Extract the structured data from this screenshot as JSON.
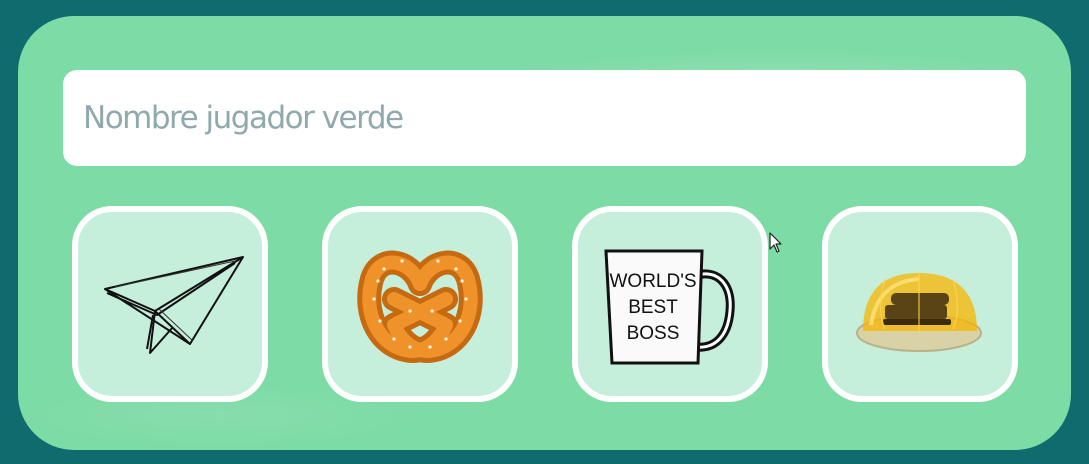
{
  "player_name": {
    "placeholder": "Nombre jugador verde",
    "value": ""
  },
  "tokens": [
    {
      "icon": "paper-airplane-icon"
    },
    {
      "icon": "pretzel-icon"
    },
    {
      "icon": "mug-icon",
      "mug_text": [
        "WORLD'S",
        "BEST",
        "BOSS"
      ]
    },
    {
      "icon": "stapler-in-jello-icon"
    }
  ],
  "colors": {
    "background": "#0f6b6e",
    "panel": "#7ddba5",
    "tile_fill": "#c5eedb",
    "tile_border": "#ffffff",
    "placeholder": "#8fa9ad"
  }
}
